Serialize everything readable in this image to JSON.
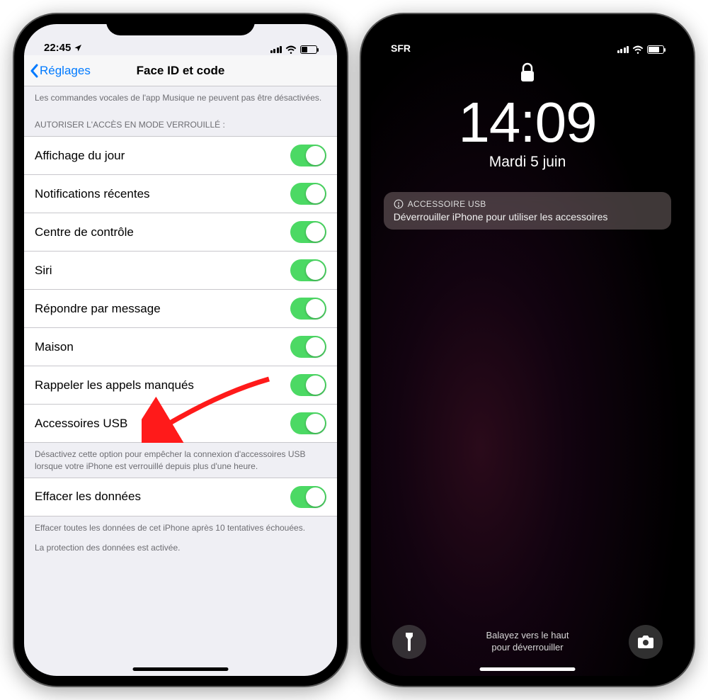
{
  "left": {
    "status": {
      "time": "22:45",
      "carrier": ""
    },
    "nav": {
      "back": "Réglages",
      "title": "Face ID et code"
    },
    "topFooter": "Les commandes vocales de l'app Musique ne peuvent pas être désactivées.",
    "sectionHeader": "AUTORISER L'ACCÈS EN MODE VERROUILLÉ :",
    "toggles": [
      {
        "label": "Affichage du jour",
        "on": true
      },
      {
        "label": "Notifications récentes",
        "on": true
      },
      {
        "label": "Centre de contrôle",
        "on": true
      },
      {
        "label": "Siri",
        "on": true
      },
      {
        "label": "Répondre par message",
        "on": true
      },
      {
        "label": "Maison",
        "on": true
      },
      {
        "label": "Rappeler les appels manqués",
        "on": true
      },
      {
        "label": "Accessoires USB",
        "on": true
      }
    ],
    "usbFooter": "Désactivez cette option pour empêcher la connexion d'accessoires USB lorsque votre iPhone est verrouillé depuis plus d'une heure.",
    "erase": {
      "label": "Effacer les données",
      "on": true
    },
    "eraseFooter1": "Effacer toutes les données de cet iPhone après 10 tentatives échouées.",
    "eraseFooter2": "La protection des données est activée."
  },
  "right": {
    "status": {
      "carrier": "SFR"
    },
    "time": "14:09",
    "date": "Mardi 5 juin",
    "notification": {
      "title": "ACCESSOIRE USB",
      "body": "Déverrouiller iPhone pour utiliser les accessoires"
    },
    "swipeHint1": "Balayez vers le haut",
    "swipeHint2": "pour déverrouiller"
  }
}
